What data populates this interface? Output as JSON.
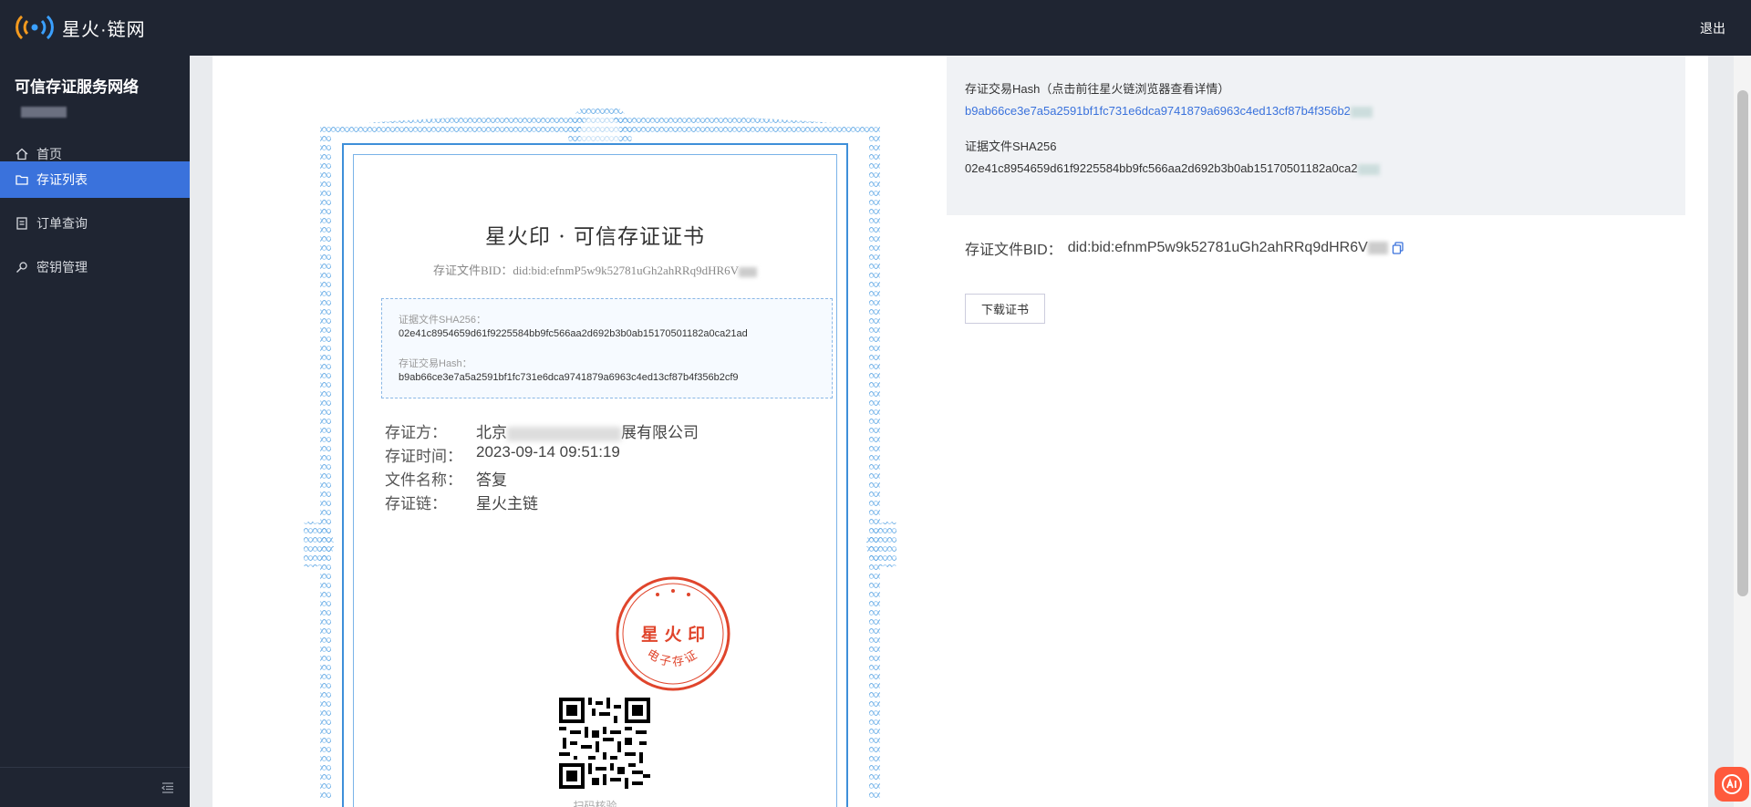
{
  "header": {
    "brand": "星火·链网",
    "logout_label": "退出"
  },
  "sidebar": {
    "title": "可信存证服务网络",
    "items": [
      {
        "label": "首页",
        "icon": "home-icon"
      },
      {
        "label": "存证列表",
        "icon": "folder-icon",
        "active": true
      },
      {
        "label": "订单查询",
        "icon": "receipt-icon"
      },
      {
        "label": "密钥管理",
        "icon": "key-icon"
      }
    ]
  },
  "certificate": {
    "title": "星火印 · 可信存证证书",
    "bid_label": "存证文件BID：",
    "bid_value": "did:bid:efnmP5w9k52781uGh2ahRRq9dHR6V",
    "sha_label": "证据文件SHA256：",
    "sha_value": "02e41c8954659d61f9225584bb9fc566aa2d692b3b0ab15170501182a0ca21ad",
    "hash_label": "存证交易Hash：",
    "hash_value": "b9ab66ce3e7a5a2591bf1fc731e6dca9741879a6963c4ed13cf87b4f356b2cf9",
    "info": [
      {
        "key": "存证方：",
        "value_prefix": "北京",
        "value_suffix": "展有限公司"
      },
      {
        "key": "存证时间：",
        "value": "2023-09-14 09:51:19"
      },
      {
        "key": "文件名称：",
        "value": "答复"
      },
      {
        "key": "存证链：",
        "value": "星火主链"
      }
    ],
    "seal_text_top": "星 火 印",
    "seal_text_bottom": "电子存证",
    "qr_caption": "扫码核验"
  },
  "panel": {
    "tx_hash_label": "存证交易Hash（点击前往星火链浏览器查看详情）",
    "tx_hash_value": "b9ab66ce3e7a5a2591bf1fc731e6dca9741879a6963c4ed13cf87b4f356b2",
    "sha_label": "证据文件SHA256",
    "sha_value": "02e41c8954659d61f9225584bb9fc566aa2d692b3b0ab15170501182a0ca2",
    "bid_label": "存证文件BID：",
    "bid_value": "did:bid:efnmP5w9k52781uGh2ahRRq9dHR6V",
    "download_label": "下载证书"
  },
  "colors": {
    "header_bg": "#1f2532",
    "active_item": "#3a72dc",
    "link": "#3a72dc",
    "seal": "#e0452c"
  }
}
